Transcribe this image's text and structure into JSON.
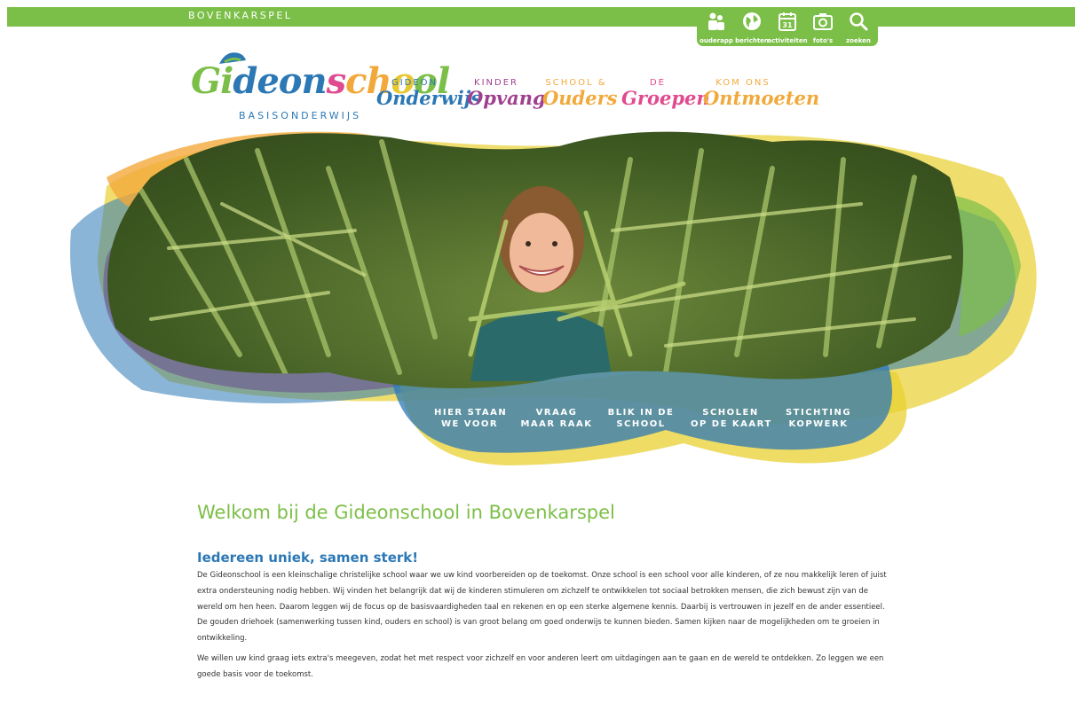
{
  "header": {
    "location": "BOVENKARSPEL"
  },
  "quicklinks": [
    {
      "label": "ouderapp",
      "icon": "parents-icon"
    },
    {
      "label": "berichten",
      "icon": "globe-icon"
    },
    {
      "label": "activiteiten",
      "icon": "calendar-icon",
      "day": "31"
    },
    {
      "label": "foto's",
      "icon": "camera-icon"
    },
    {
      "label": "zoeken",
      "icon": "search-icon"
    }
  ],
  "logo": {
    "letters": [
      {
        "ch": "G",
        "color": "#7cbf48"
      },
      {
        "ch": "i",
        "color": "#7cbf48"
      },
      {
        "ch": "d",
        "color": "#2c78b5"
      },
      {
        "ch": "e",
        "color": "#2c78b5"
      },
      {
        "ch": "o",
        "color": "#2c78b5"
      },
      {
        "ch": "n",
        "color": "#2c78b5"
      },
      {
        "ch": "s",
        "color": "#e04a8f"
      },
      {
        "ch": "c",
        "color": "#f2a93b"
      },
      {
        "ch": "h",
        "color": "#f2a93b"
      },
      {
        "ch": "o",
        "color": "#e8c832"
      },
      {
        "ch": "o",
        "color": "#7cbf48"
      },
      {
        "ch": "l",
        "color": "#7cbf48"
      }
    ],
    "subtitle": "BASISONDERWIJS"
  },
  "nav": [
    {
      "small": "GIDEON",
      "big": "Onderwijs",
      "color": "#2c78b5"
    },
    {
      "small": "KINDER",
      "big": "Opvang",
      "color": "#a03f8e"
    },
    {
      "small": "SCHOOL &",
      "big": "Ouders",
      "color": "#f2a93b"
    },
    {
      "small": "DE",
      "big": "Groepen",
      "color": "#e04a8f"
    },
    {
      "small": "KOM ONS",
      "big": "Ontmoeten",
      "color": "#f2a93b"
    }
  ],
  "subnav": [
    {
      "line1": "HIER STAAN",
      "line2": "WE VOOR"
    },
    {
      "line1": "VRAAG",
      "line2": "MAAR RAAK"
    },
    {
      "line1": "BLIK IN DE",
      "line2": "SCHOOL"
    },
    {
      "line1": "SCHOLEN",
      "line2": "OP DE KAART"
    },
    {
      "line1": "STICHTING",
      "line2": "KOPWERK"
    }
  ],
  "content": {
    "title": "Welkom bij de Gideonschool in Bovenkarspel",
    "subtitle": "Iedereen uniek, samen sterk!",
    "paragraph1": "De Gideonschool is een kleinschalige christelijke school waar we uw kind voorbereiden op de toekomst. Onze school is een school voor alle kinderen, of ze nou makkelijk leren of juist extra ondersteuning nodig hebben. Wij vinden het belangrijk dat wij de kinderen stimuleren om zichzelf te ontwikkelen tot sociaal betrokken mensen, die zich bewust zijn van de wereld om hen heen. Daarom leggen wij de focus op de basisvaardigheden taal en rekenen en op een sterke algemene kennis. Daarbij is vertrouwen in jezelf en de ander essentieel. De gouden driehoek (samenwerking tussen kind, ouders en school) is van groot belang om goed onderwijs te kunnen bieden. Samen kijken naar de mogelijkheden om te groeien in ontwikkeling.",
    "paragraph2": "We willen uw kind graag iets extra's meegeven, zodat het met respect voor zichzelf en voor anderen leert om uitdagingen aan te gaan en de wereld te ontdekken. Zo leggen we een goede basis voor de toekomst."
  },
  "colors": {
    "green": "#7cbf48",
    "blue": "#2c78b5",
    "yellow": "#e8d030",
    "orange": "#f2a93b",
    "purple": "#6a4a8f",
    "pink": "#e04a8f"
  }
}
